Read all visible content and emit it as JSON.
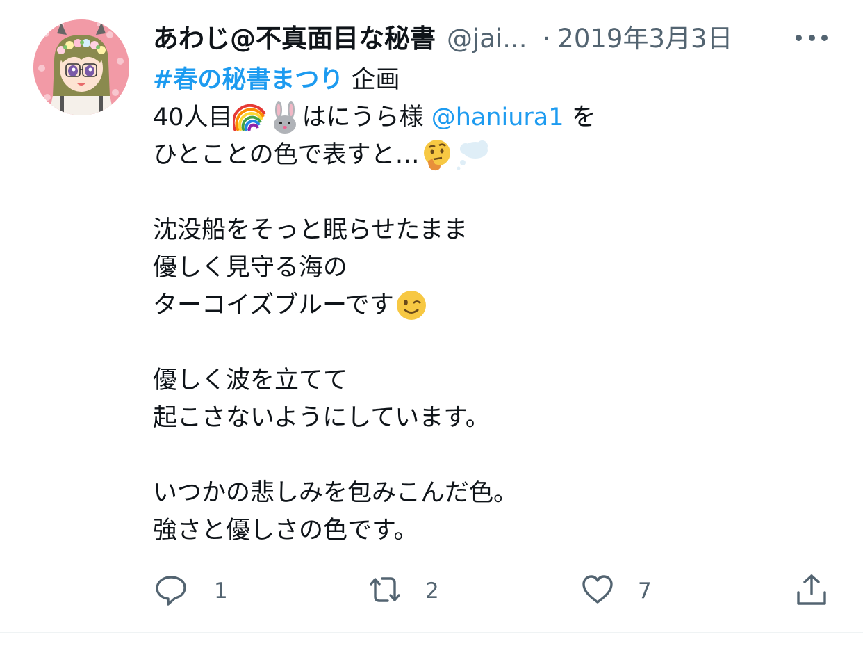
{
  "tweet": {
    "display_name": "あわじ@不真面目な秘書",
    "handle": "@jai...",
    "separator": "·",
    "date": "2019年3月3日",
    "avatar_icon": "anime-girl-avatar",
    "more_icon": "more-horizontal-icon",
    "lines": {
      "l1_hashtag": "#春の秘書まつり",
      "l1_text": " 企画",
      "l2_text_a": "40人目",
      "l2_emoji_a": "rainbow-emoji",
      "l2_emoji_b": "rabbit-emoji",
      "l2_text_b": "はにうら様 ",
      "l2_mention": "@haniura1",
      "l2_text_c": " を",
      "l3_text": "ひとことの色で表すと…",
      "l3_emoji_a": "thinking-face-emoji",
      "l3_emoji_b": "thought-balloon-emoji",
      "l5": "沈没船をそっと眠らせたまま",
      "l6": "優しく見守る海の",
      "l7_text": "ターコイズブルーです",
      "l7_emoji": "winking-face-emoji",
      "l9": "優しく波を立てて",
      "l10": "起こさないようにしています。",
      "l12": "いつかの悲しみを包みこんだ色。",
      "l13": "強さと優しさの色です。"
    },
    "actions": {
      "reply": {
        "icon": "reply-icon",
        "count": "1"
      },
      "retweet": {
        "icon": "retweet-icon",
        "count": "2"
      },
      "like": {
        "icon": "heart-icon",
        "count": "7"
      },
      "share": {
        "icon": "share-icon"
      }
    },
    "colors": {
      "link": "#1d9bf0",
      "text": "#0f1419",
      "secondary": "#536471"
    }
  }
}
